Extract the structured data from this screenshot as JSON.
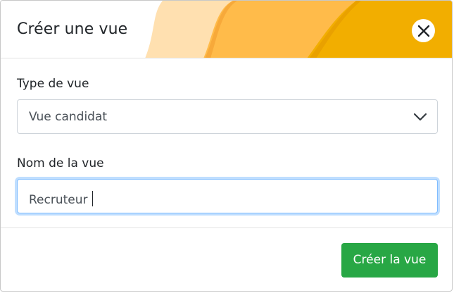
{
  "modal": {
    "title": "Créer une vue"
  },
  "form": {
    "type_label": "Type de vue",
    "type_value": "Vue candidat",
    "name_label": "Nom de la vue",
    "name_value": "Recruteur"
  },
  "footer": {
    "submit_label": "Créer la vue"
  },
  "colors": {
    "accent_dark": "#f2ae00",
    "accent_mid": "#ffbb4a",
    "accent_light": "#ffe0b0",
    "submit": "#28a745",
    "focus_border": "#80bdff"
  },
  "icons": {
    "close": "close-icon",
    "select": "chevron-down-icon"
  }
}
